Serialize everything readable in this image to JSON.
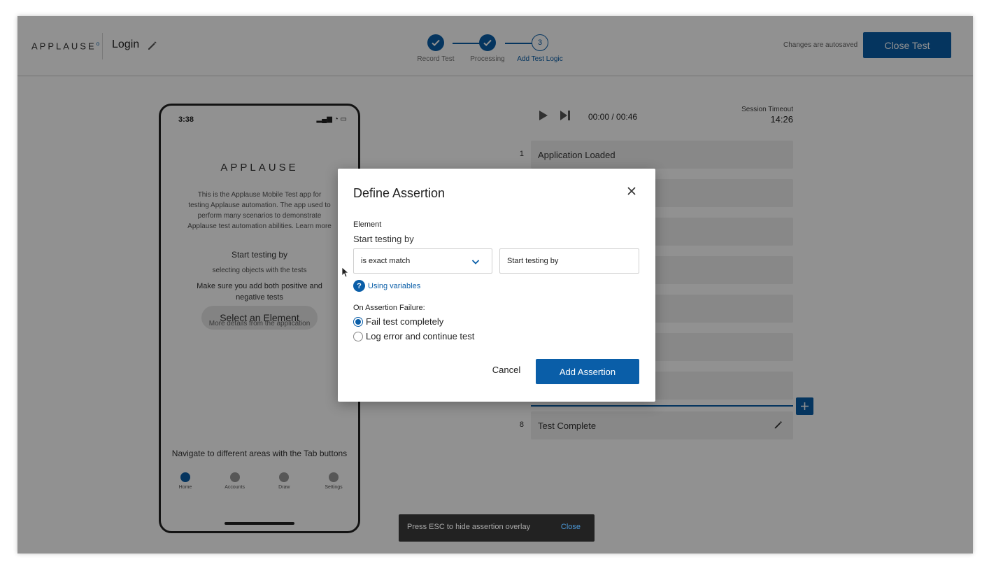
{
  "header": {
    "logo": "APPLAUSE",
    "test_name": "Login",
    "steps": [
      {
        "label": "Record Test",
        "number": "1",
        "state": "done"
      },
      {
        "label": "Processing",
        "number": "2",
        "state": "done"
      },
      {
        "label": "Add Test Logic",
        "number": "3",
        "state": "current"
      }
    ],
    "autosave_text": "Changes are autosaved",
    "close_test_label": "Close Test"
  },
  "phone": {
    "time": "3:38",
    "logo": "APPLAUSE",
    "description": "This is the Applause Mobile Test app for testing Applause automation. The app used to perform many scenarios to demonstrate Applause test automation abilities. Learn more",
    "start_testing": "Start testing by",
    "sub_line": "selecting objects with the tests",
    "make_sure": "Make sure you add both positive and negative tests",
    "select_element": "Select an Element",
    "more_info": "More details from the application",
    "nav_hint": "Navigate to different areas with the Tab buttons",
    "tabs": [
      "Home",
      "Accounts",
      "Draw",
      "Settings"
    ]
  },
  "player": {
    "time": "00:00 / 00:46",
    "session_label": "Session Timeout",
    "session_value": "14:26"
  },
  "test_steps": [
    {
      "num": "1",
      "label": "Application Loaded"
    },
    {
      "num": "8",
      "label": "Test Complete"
    }
  ],
  "modal": {
    "title": "Define Assertion",
    "element_label": "Element",
    "element_value": "Start testing by",
    "match_type": "is exact match",
    "match_value": "Start testing by",
    "help_link": "Using variables",
    "failure_label": "On Assertion Failure:",
    "options": [
      {
        "label": "Fail test completely",
        "checked": true
      },
      {
        "label": "Log error and continue test",
        "checked": false
      }
    ],
    "cancel_label": "Cancel",
    "add_label": "Add Assertion"
  },
  "toast": {
    "text": "Press ESC to hide assertion overlay",
    "close_label": "Close"
  },
  "colors": {
    "accent": "#0a5ea8",
    "overlay": "rgba(0,0,0,0.43)"
  }
}
